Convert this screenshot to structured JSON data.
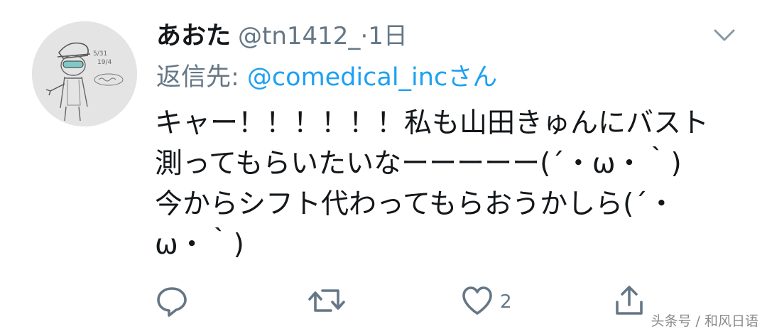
{
  "tweet": {
    "display_name": "あおた",
    "handle": "@tn1412_",
    "separator": "·",
    "time": "1日",
    "reply_prefix": "返信先: ",
    "reply_mention": "@comedical_inc",
    "reply_suffix": "さん",
    "text": "キャー！！！！！！私も山田きゅんにバスト測ってもらいたいなーーーーー(´・ω・｀) 今からシフト代わってもらおうかしら(´・ω・｀)",
    "like_count": "2"
  },
  "watermark": "头条号 / 和风日语",
  "colors": {
    "text": "#14171a",
    "secondary": "#657786",
    "link": "#1da1f2"
  },
  "icons": [
    "chevron-down-icon",
    "reply-icon",
    "retweet-icon",
    "like-icon",
    "share-icon"
  ]
}
